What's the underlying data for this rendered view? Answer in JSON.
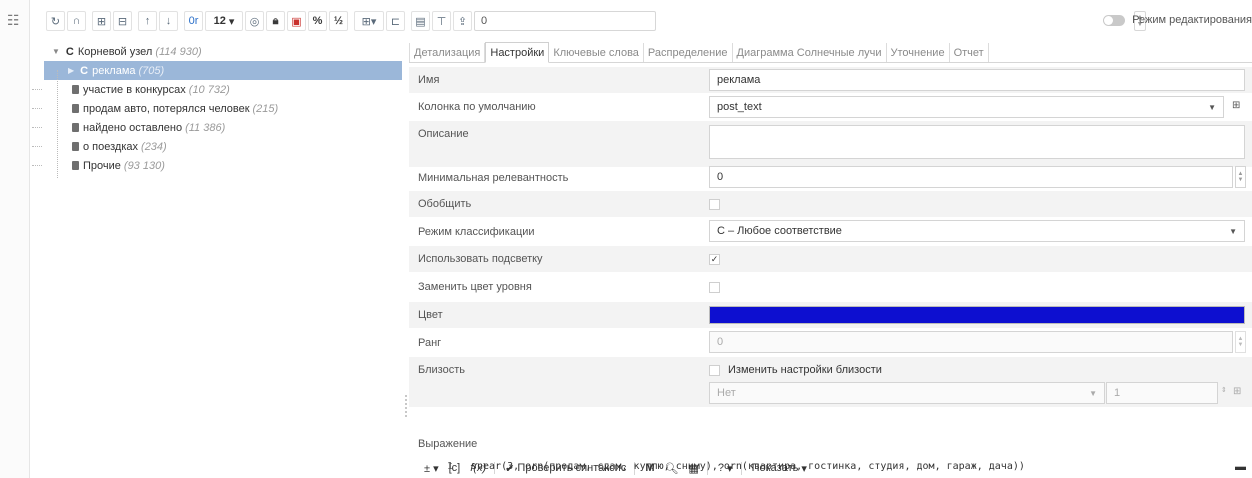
{
  "toolbar": {
    "num_label": "12",
    "field_value": "0"
  },
  "mode": {
    "label": "Режим редактирования"
  },
  "tree": {
    "root": {
      "badge": "C",
      "label": "Корневой узел",
      "count": "(114 930)"
    },
    "selected": {
      "badge": "C",
      "label": "реклама",
      "count": "(705)"
    },
    "children": [
      {
        "label": "участие в конкурсах",
        "count": "(10 732)"
      },
      {
        "label": "продам авто, потерялся человек",
        "count": "(215)"
      },
      {
        "label": "найдено оставлено",
        "count": "(11 386)"
      },
      {
        "label": "о поездках",
        "count": "(234)"
      },
      {
        "label": "Прочие",
        "count": "(93 130)"
      }
    ]
  },
  "tabs": [
    "Детализация",
    "Настройки",
    "Ключевые слова",
    "Распределение",
    "Диаграмма Солнечные лучи",
    "Уточнение",
    "Отчет"
  ],
  "form": {
    "name": {
      "label": "Имя",
      "value": "реклама"
    },
    "default_column": {
      "label": "Колонка по умолчанию",
      "value": "post_text"
    },
    "description": {
      "label": "Описание",
      "value": ""
    },
    "min_relevance": {
      "label": "Минимальная релевантность",
      "value": "0"
    },
    "generalize": {
      "label": "Обобщить",
      "checked": false
    },
    "classification_mode": {
      "label": "Режим классификации",
      "value": "C – Любое соответствие"
    },
    "use_highlight": {
      "label": "Использовать подсветку",
      "checked": true,
      "mark": "✓"
    },
    "replace_level_color": {
      "label": "Заменить цвет уровня",
      "checked": false
    },
    "color": {
      "label": "Цвет",
      "value": "#0d0fd0"
    },
    "rank": {
      "label": "Ранг",
      "value": "0"
    },
    "proximity": {
      "label": "Близость",
      "checkbox_label": "Изменить настройки близости",
      "select_value": "Нет",
      "number_value": "1"
    }
  },
  "expression": {
    "label": "Выражение",
    "check_syntax": "Проверить синтаксис",
    "show": "Показать",
    "m": "M",
    "q": "?",
    "line_no": "1",
    "code": "snear(3, orn(продам, сдам, куплю, сниму), orn(квартира, гостинка, студия, дом, гараж, дача))"
  },
  "colors": {
    "selection": "#9bb7d9",
    "swatch": "#0d0fd0"
  }
}
